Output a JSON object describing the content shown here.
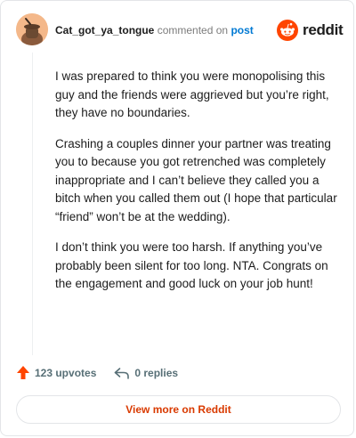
{
  "header": {
    "username": "Cat_got_ya_tongue",
    "action_text": "commented on",
    "post_link": "post"
  },
  "logo": {
    "wordmark": "reddit",
    "icon": "reddit-alien-icon",
    "color": "#ff4500"
  },
  "comment": {
    "paragraphs": [
      "I was prepared to think you were monopolising this guy and the friends were aggrieved but you’re right, they have no boundaries.",
      "Crashing a couples dinner your partner was treating you to because you got retrenched was completely inappropriate and I can’t believe they called you a bitch when you called them out (I hope that particular “friend” won’t be at the wedding).",
      "I don’t think you were too harsh. If anything you’ve probably been silent for too long. NTA. Congrats on the engagement and good luck on your job hunt!"
    ]
  },
  "actions": {
    "upvotes": "123 upvotes",
    "replies": "0 replies",
    "upvote_icon": "upvote-arrow-icon",
    "reply_icon": "reply-arrow-icon"
  },
  "footer": {
    "view_more": "View more on Reddit"
  }
}
